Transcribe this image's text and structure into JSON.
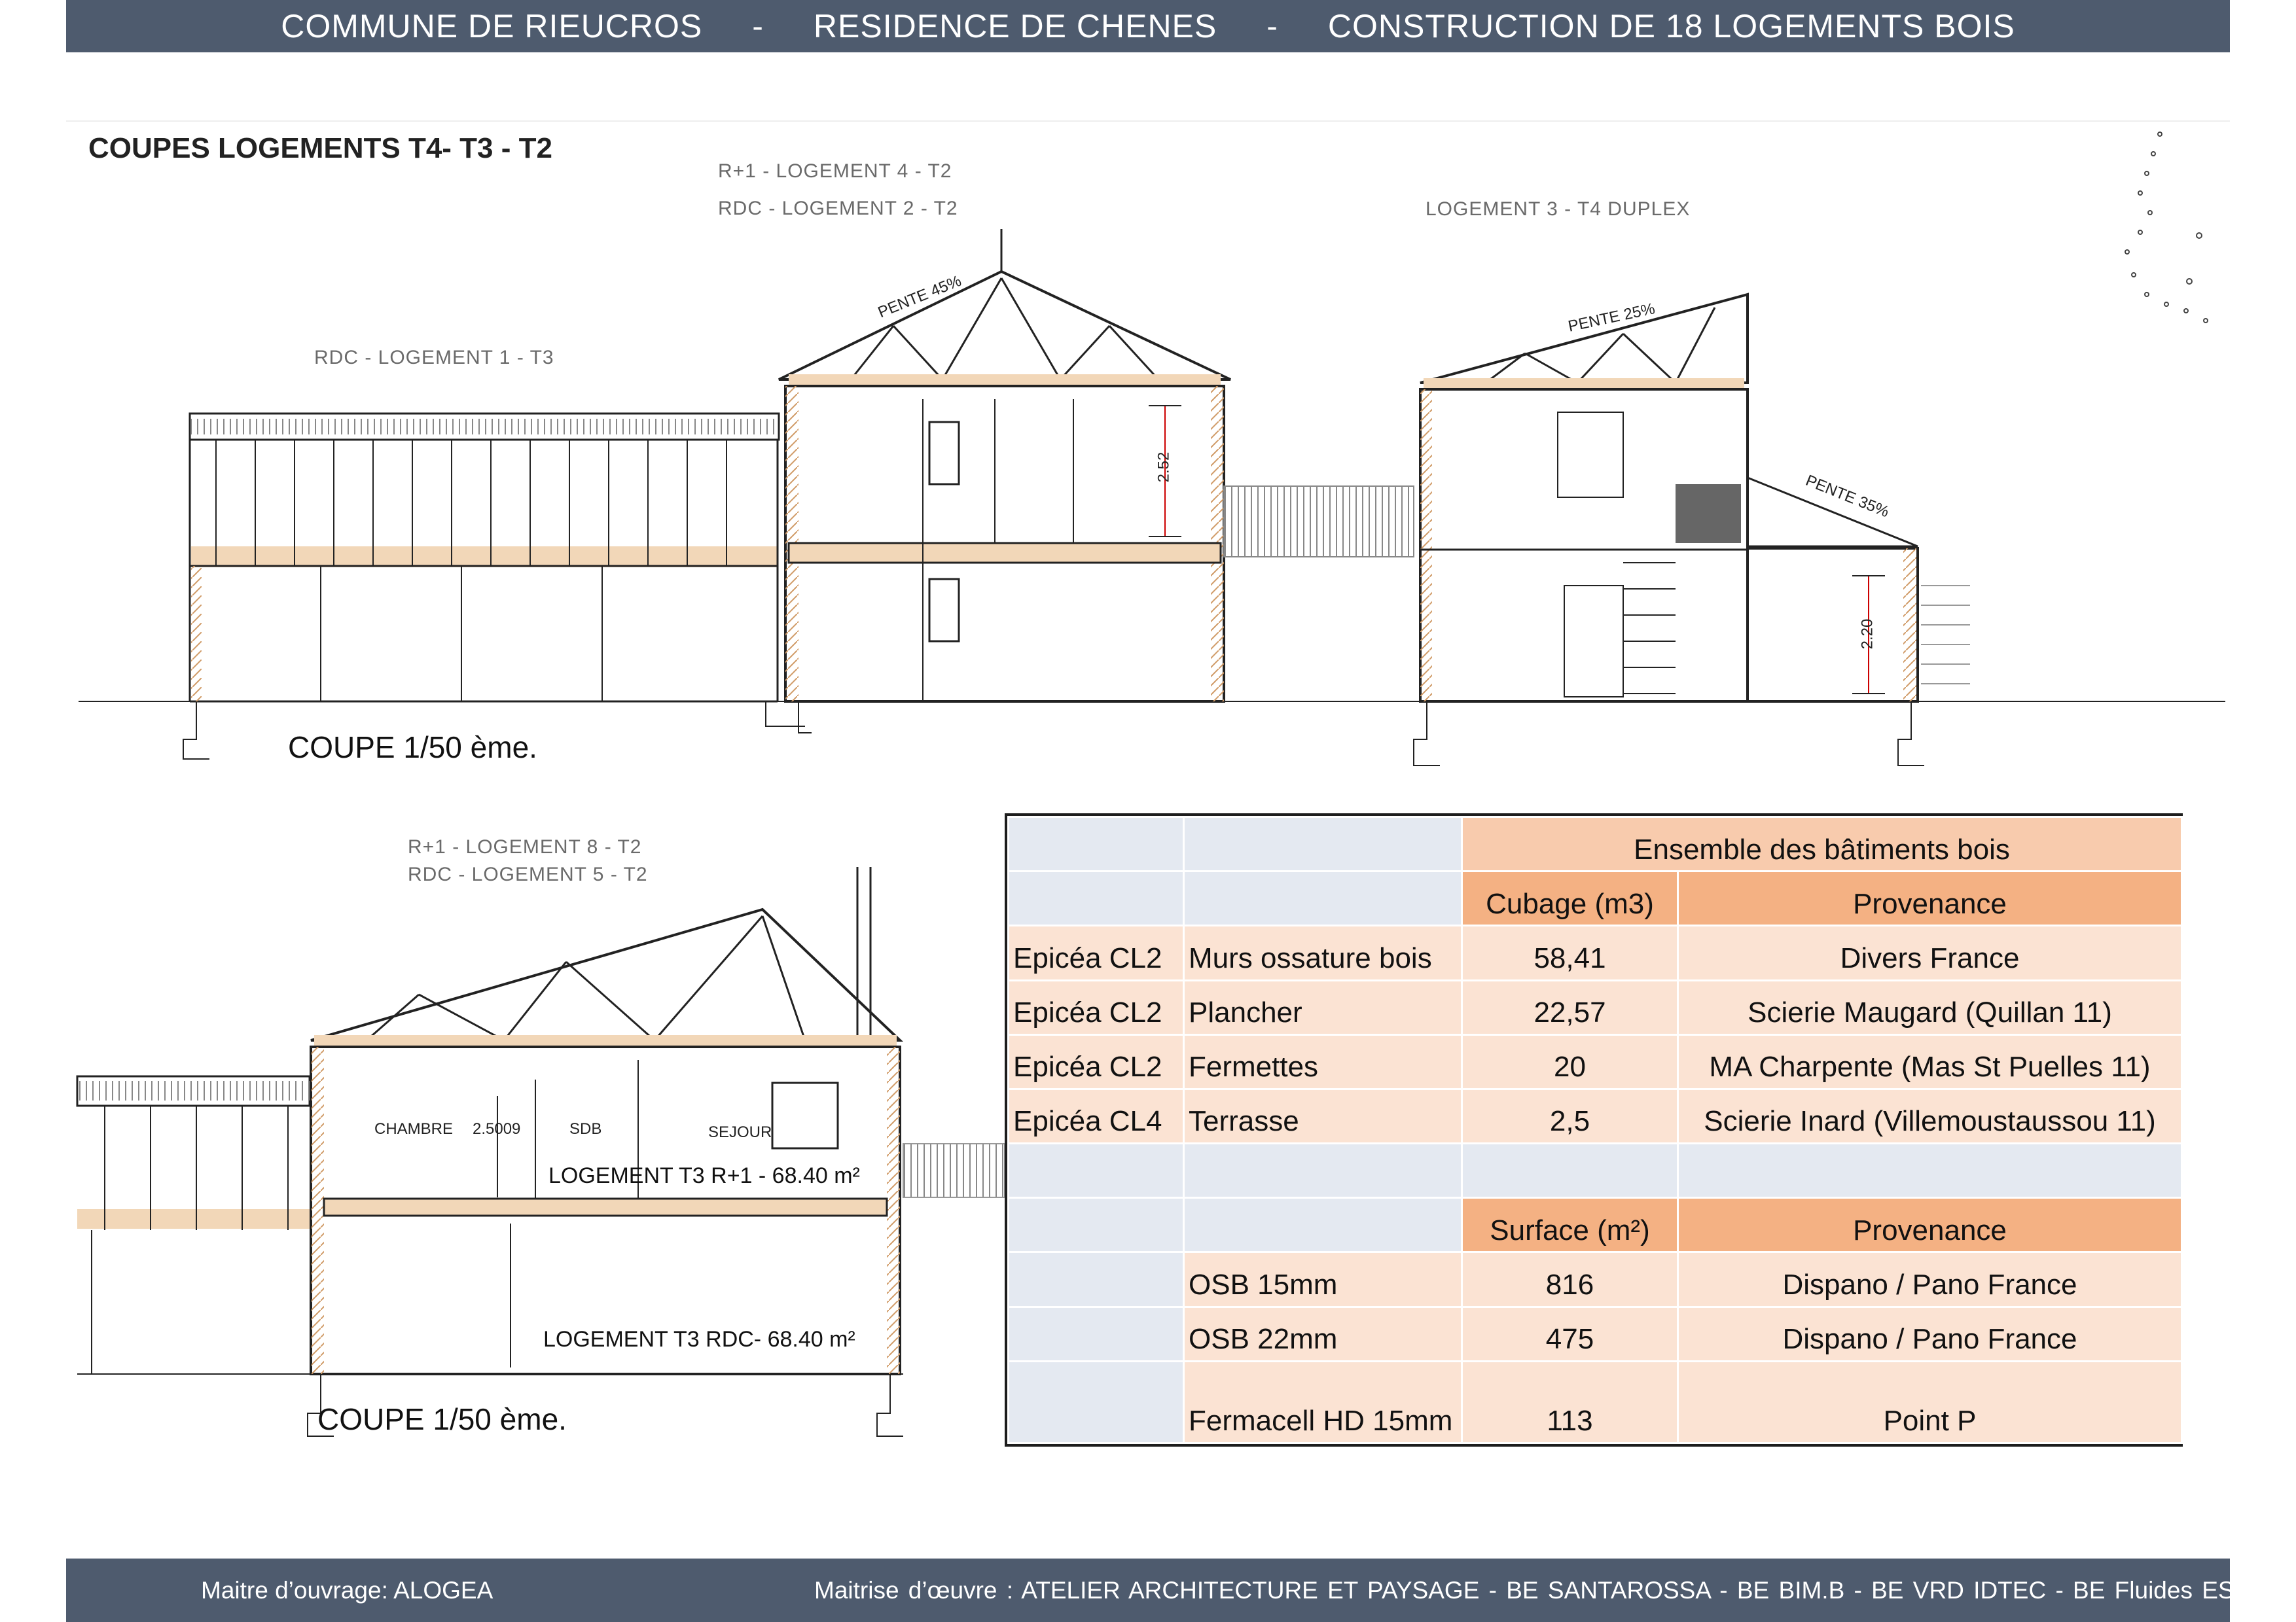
{
  "header": {
    "parts": [
      "COMMUNE DE RIEUCROS",
      "-",
      "RESIDENCE DE CHENES",
      "-",
      "CONSTRUCTION DE 18 LOGEMENTS BOIS"
    ]
  },
  "sheet": {
    "title": "COUPES LOGEMENTS T4- T3 - T2"
  },
  "section_top": {
    "label_rdc_l1": "RDC - LOGEMENT 1 - T3",
    "label_r1_l4": "R+1 - LOGEMENT 4 - T2",
    "label_rdc_l2": "RDC - LOGEMENT 2 - T2",
    "label_l3": "LOGEMENT 3  - T4 DUPLEX",
    "pente_45": "PENTE 45%",
    "pente_25": "PENTE 25%",
    "pente_35": "PENTE 35%",
    "height_252": "2.52",
    "height_220": "2.20",
    "scale": "COUPE 1/50  ème."
  },
  "section_bottom": {
    "label_r1_l8": "R+1 - LOGEMENT 8 - T2",
    "label_rdc_l5": "RDC - LOGEMENT 5 - T2",
    "room_chambre": "CHAMBRE",
    "room_height": "2.5009",
    "room_sdb": "SDB",
    "room_sejour": "SEJOUR",
    "area_r1": "LOGEMENT T3 R+1 - 68.40 m²",
    "area_rdc": "LOGEMENT T3 RDC- 68.40 m²",
    "scale": "COUPE 1/50  ème."
  },
  "materials_table": {
    "group_header": "Ensemble des bâtiments bois",
    "col_volume": "Cubage (m3)",
    "col_origin": "Provenance",
    "volume_rows": [
      {
        "wood": "Epicéa CL2",
        "element": "Murs ossature bois",
        "value": "58,41",
        "origin": "Divers France"
      },
      {
        "wood": "Epicéa CL2",
        "element": "Plancher",
        "value": "22,57",
        "origin": "Scierie Maugard (Quillan 11)"
      },
      {
        "wood": "Epicéa CL2",
        "element": "Fermettes",
        "value": "20",
        "origin": "MA Charpente (Mas St Puelles 11)"
      },
      {
        "wood": "Epicéa CL4",
        "element": "Terrasse",
        "value": "2,5",
        "origin": "Scierie Inard (Villemoustaussou 11)"
      }
    ],
    "col_surface": "Surface (m²)",
    "col_origin2": "Provenance",
    "surface_rows": [
      {
        "element": "OSB 15mm",
        "value": "816",
        "origin": "Dispano / Pano France"
      },
      {
        "element": "OSB 22mm",
        "value": "475",
        "origin": "Dispano / Pano France"
      },
      {
        "element": "Fermacell HD 15mm",
        "value": "113",
        "origin": "Point P"
      }
    ]
  },
  "footer": {
    "owner": "Maitre d’ouvrage:   ALOGEA",
    "team": "Maitrise d’œuvre :   ATELIER ARCHITECTURE ET PAYSAGE   -  BE SANTAROSSA   -  BE BIM.B  -  BE VRD  IDTEC   -  BE Fluides ESI"
  },
  "colors": {
    "banner": "#4e5b6e",
    "table_blue": "#e4e9f1",
    "table_light_orange": "#fbe3d3",
    "table_orange": "#f4b183",
    "timber": "#c98a4a"
  }
}
